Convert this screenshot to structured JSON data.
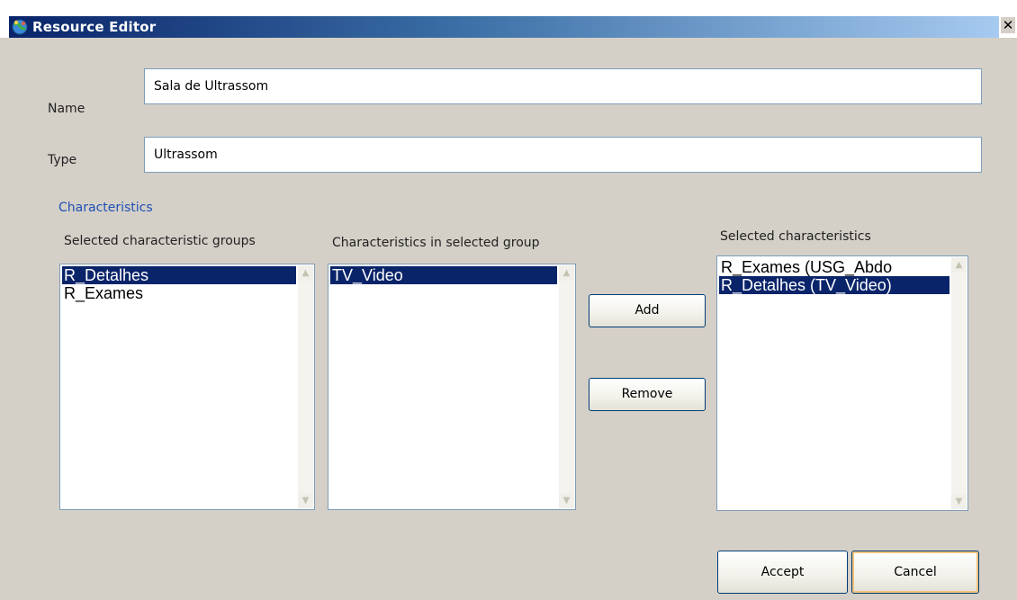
{
  "window": {
    "title": "Resource Editor",
    "close_glyph": "✕",
    "icon": "globe-people-icon"
  },
  "form": {
    "name_label": "Name",
    "name_value": "Sala de Ultrassom",
    "type_label": "Type",
    "type_value": "Ultrassom"
  },
  "characteristics": {
    "section_title": "Characteristics",
    "groups": {
      "header": "Selected characteristic groups",
      "items": [
        "R_Detalhes",
        "R_Exames"
      ],
      "selected_index": 0
    },
    "in_group": {
      "header": "Characteristics in selected group",
      "items": [
        "TV_Video"
      ],
      "selected_index": 0
    },
    "selected": {
      "header": "Selected characteristics",
      "items": [
        "R_Exames (USG_Abdo",
        "R_Detalhes (TV_Video)"
      ],
      "selected_index": 1
    },
    "add_label": "Add",
    "remove_label": "Remove"
  },
  "footer": {
    "accept_label": "Accept",
    "cancel_label": "Cancel"
  },
  "colors": {
    "title_gradient_start": "#0a246a",
    "title_gradient_end": "#a6caf0",
    "selection": "#0a246a",
    "link": "#1f4fb5",
    "dialog_background": "#d4d0c8",
    "default_button_highlight": "#f2c37a"
  }
}
